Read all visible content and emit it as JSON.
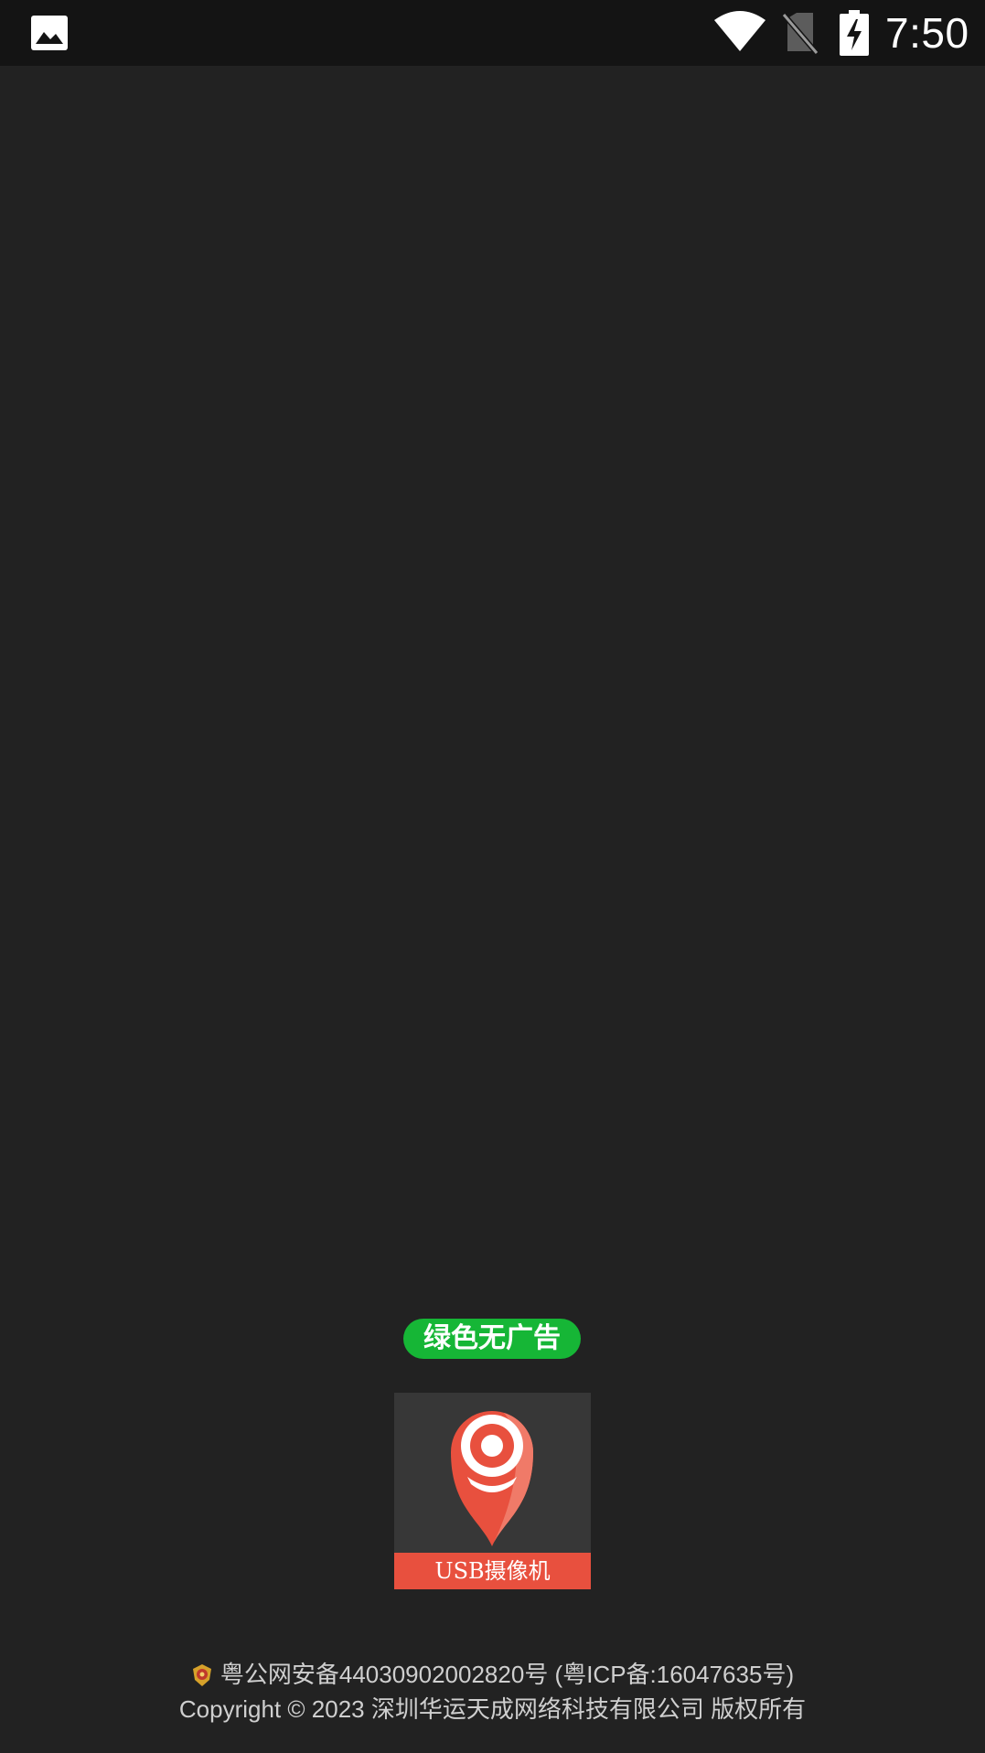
{
  "status_bar": {
    "time": "7:50",
    "icons": [
      "gallery-icon",
      "wifi-icon",
      "no-sim-icon",
      "battery-charging-icon"
    ]
  },
  "splash": {
    "badge_text": "绿色无广告",
    "badge_color": "#16b636",
    "logo_label": "USB摄像机",
    "logo_accent_color": "#e8503e",
    "background_color": "#222222"
  },
  "footer": {
    "registration": "粤公网安备44030902002820号 (粤ICP备:16047635号)",
    "copyright": "Copyright © 2023 深圳华运天成网络科技有限公司 版权所有",
    "icon": "police-badge-icon"
  }
}
